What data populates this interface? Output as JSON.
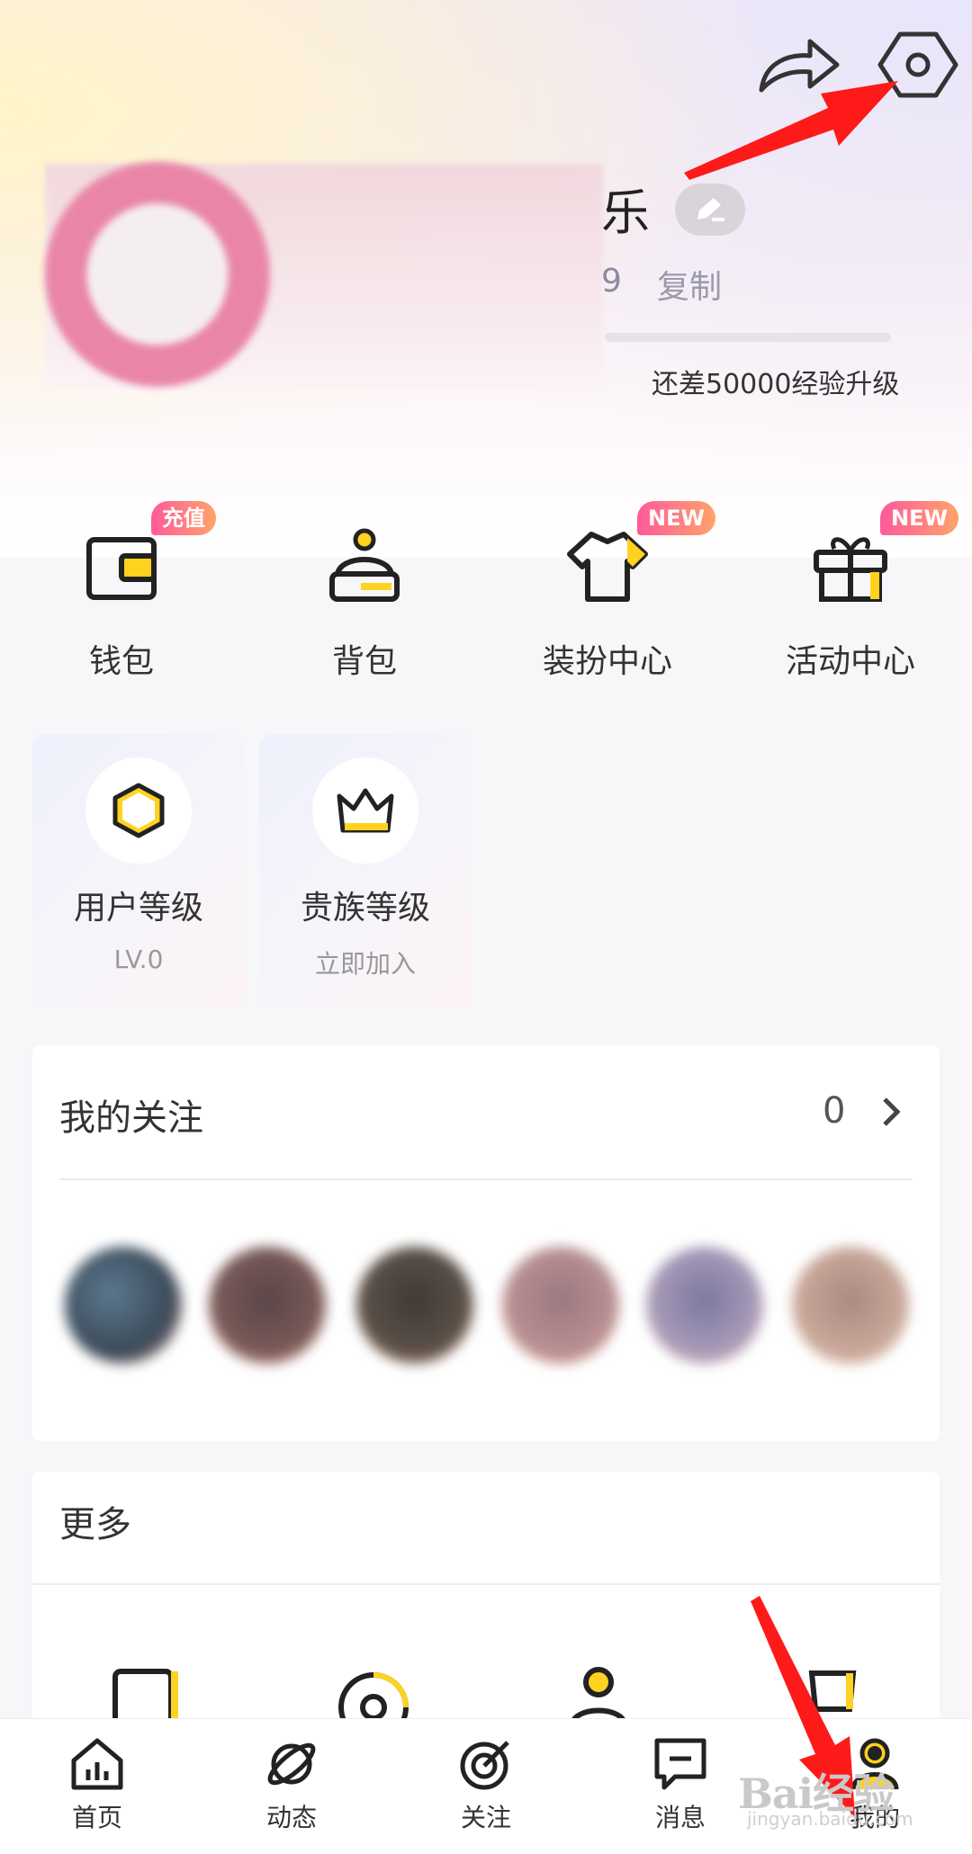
{
  "header": {
    "share_icon": "share-icon",
    "settings_icon": "gear-icon"
  },
  "profile": {
    "name_visible_suffix": "乐",
    "id_visible_suffix": "9",
    "copy_label": "复制",
    "exp_text": "还差50000经验升级"
  },
  "shortcuts": [
    {
      "label": "钱包",
      "icon": "wallet-icon",
      "badge": "充值"
    },
    {
      "label": "背包",
      "icon": "backpack-icon",
      "badge": ""
    },
    {
      "label": "装扮中心",
      "icon": "shirt-icon",
      "badge": "NEW"
    },
    {
      "label": "活动中心",
      "icon": "gift-icon",
      "badge": "NEW"
    }
  ],
  "levels": [
    {
      "title": "用户等级",
      "sub": "LV.0",
      "icon": "hexagon-icon"
    },
    {
      "title": "贵族等级",
      "sub": "立即加入",
      "icon": "crown-icon"
    }
  ],
  "follow": {
    "title": "我的关注",
    "count": "0"
  },
  "more": {
    "title": "更多"
  },
  "nav": [
    {
      "label": "首页",
      "icon": "home-chart-icon"
    },
    {
      "label": "动态",
      "icon": "planet-icon"
    },
    {
      "label": "关注",
      "icon": "target-icon"
    },
    {
      "label": "消息",
      "icon": "message-icon"
    },
    {
      "label": "我的",
      "icon": "profile-icon"
    }
  ],
  "watermark": {
    "text": "Bai经验",
    "sub": "jingyan.baidu.com"
  },
  "colors": {
    "accent_yellow": "#ffd21f",
    "badge_pink": "#ff5a9a",
    "annotation_red": "#ff1a1a"
  }
}
